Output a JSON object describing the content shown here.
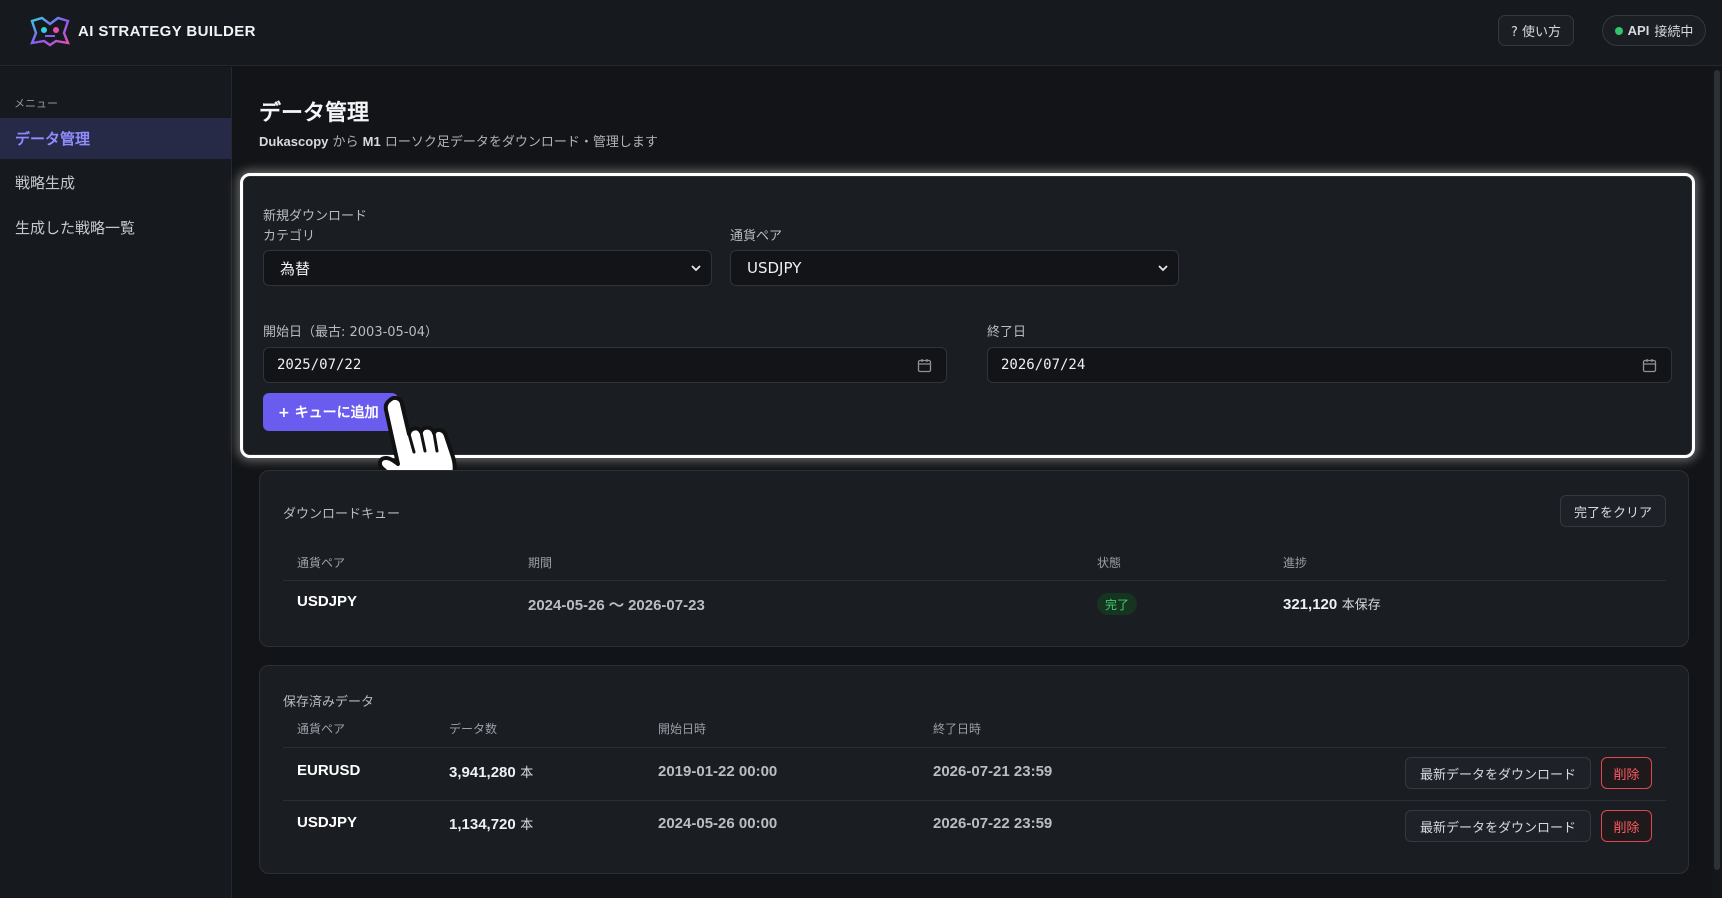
{
  "header": {
    "brand": "AI STRATEGY BUILDER",
    "help_label": "? 使い方",
    "api_status_bold": "API",
    "api_status_text": "接続中",
    "colors": {
      "background": "#16191d",
      "accent": "#6b5cf0",
      "status_ok": "#31c46b"
    }
  },
  "sidebar": {
    "caption": "メニュー",
    "items": [
      {
        "label": "データ管理",
        "active": true
      },
      {
        "label": "戦略生成",
        "active": false
      },
      {
        "label": "生成した戦略一覧",
        "active": false
      }
    ]
  },
  "page": {
    "title": "データ管理",
    "subtitle_source": "Dukascopy",
    "subtitle_mid": " から ",
    "subtitle_tf": "M1",
    "subtitle_rest": " ローソク足データをダウンロード・管理します"
  },
  "new_download": {
    "section_label": "新規ダウンロード",
    "category_label": "カテゴリ",
    "category_value": "為替",
    "pair_label": "通貨ペア",
    "pair_value": "USDJPY",
    "start_label": "開始日（最古: 2003-05-04）",
    "start_value": "2025/07/22",
    "end_label": "終了日",
    "end_value": "2026/07/24",
    "add_button": "+ キューに追加"
  },
  "queue": {
    "title": "ダウンロードキュー",
    "clear_button": "完了をクリア",
    "columns": [
      "通貨ペア",
      "期間",
      "状態",
      "進捗"
    ],
    "rows": [
      {
        "pair": "USDJPY",
        "period": "2024-05-26 〜 2026-07-23",
        "status": "完了",
        "progress_count": "321,120",
        "progress_unit": "本保存"
      }
    ]
  },
  "saved": {
    "title": "保存済みデータ",
    "columns": [
      "通貨ペア",
      "データ数",
      "開始日時",
      "終了日時"
    ],
    "download_label": "最新データをダウンロード",
    "delete_label": "削除",
    "rows": [
      {
        "pair": "EURUSD",
        "count": "3,941,280",
        "unit": "本",
        "start": "2019-01-22 00:00",
        "end": "2026-07-21 23:59"
      },
      {
        "pair": "USDJPY",
        "count": "1,134,720",
        "unit": "本",
        "start": "2024-05-26 00:00",
        "end": "2026-07-22 23:59"
      }
    ]
  }
}
